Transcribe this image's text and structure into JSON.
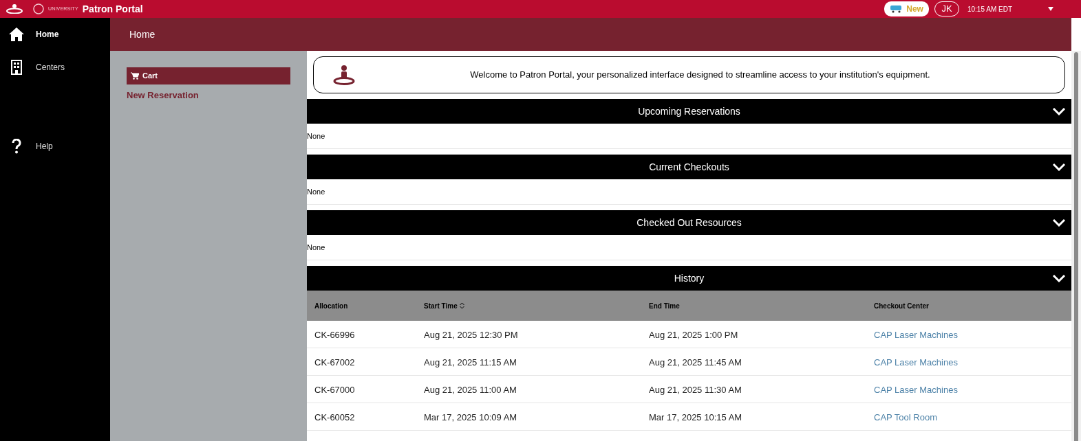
{
  "header": {
    "logo_text": "UNIVERSITY",
    "title": "Patron Portal",
    "new_label": "New",
    "avatar_initials": "JK",
    "time": "10:15 AM EDT"
  },
  "nav": {
    "items": [
      {
        "label": "Home",
        "kind": "home",
        "selected": true
      },
      {
        "label": "Centers",
        "kind": "building",
        "selected": false
      },
      {
        "label": "Help",
        "kind": "help",
        "selected": false
      }
    ]
  },
  "page_title": "Home",
  "side_panel": {
    "cart_label": "Cart",
    "link": "New Reservation"
  },
  "welcome": "Welcome to Patron Portal, your personalized interface designed to streamline access to your institution's equipment.",
  "sections": [
    {
      "title": "Upcoming Reservations",
      "expanded": true,
      "empty_text": "None"
    },
    {
      "title": "Current Checkouts",
      "expanded": true,
      "empty_text": "None"
    },
    {
      "title": "Checked Out Resources",
      "expanded": true,
      "empty_text": "None"
    }
  ],
  "history": {
    "title": "History",
    "columns": [
      "Allocation",
      "Start Time",
      "End Time",
      "Checkout Center"
    ],
    "rows": [
      [
        "CK-66996",
        "Aug 21, 2025 12:30 PM",
        "Aug 21, 2025 1:00 PM",
        "CAP Laser Machines"
      ],
      [
        "CK-67002",
        "Aug 21, 2025 11:15 AM",
        "Aug 21, 2025 11:45 AM",
        "CAP Laser Machines"
      ],
      [
        "CK-67000",
        "Aug 21, 2025 11:00 AM",
        "Aug 21, 2025 11:30 AM",
        "CAP Laser Machines"
      ],
      [
        "CK-60052",
        "Mar 17, 2025 10:09 AM",
        "Mar 17, 2025 10:15 AM",
        "CAP Tool Room"
      ]
    ]
  }
}
